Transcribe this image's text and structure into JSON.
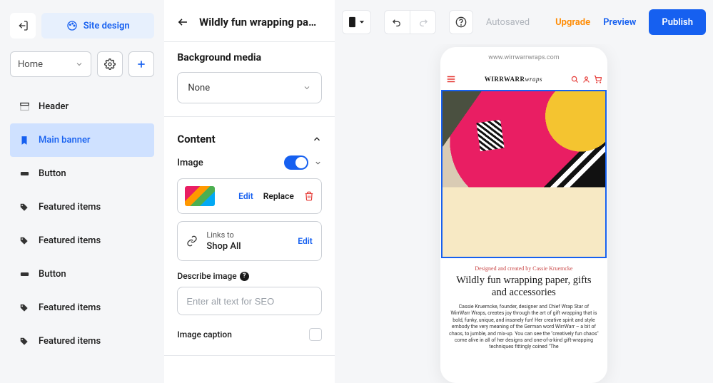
{
  "colors": {
    "primary": "#1660f0",
    "accent": "#ff8a00",
    "danger": "#e53935"
  },
  "left": {
    "site_design": "Site design",
    "page_select": "Home",
    "sections": [
      {
        "icon": "header",
        "label": "Header"
      },
      {
        "icon": "bookmark",
        "label": "Main banner",
        "active": true
      },
      {
        "icon": "button",
        "label": "Button"
      },
      {
        "icon": "tag",
        "label": "Featured items"
      },
      {
        "icon": "tag",
        "label": "Featured items"
      },
      {
        "icon": "button",
        "label": "Button"
      },
      {
        "icon": "tag",
        "label": "Featured items"
      },
      {
        "icon": "tag",
        "label": "Featured items"
      }
    ]
  },
  "mid": {
    "title": "Wildly fun wrapping paper…",
    "bg_media_label": "Background media",
    "bg_media_value": "None",
    "content_label": "Content",
    "image_label": "Image",
    "image_toggle": true,
    "edit": "Edit",
    "replace": "Replace",
    "links_to_label": "Links to",
    "links_to_value": "Shop All",
    "alt_label": "Describe image",
    "alt_placeholder": "Enter alt text for SEO",
    "caption_label": "Image caption",
    "caption_checked": false
  },
  "top": {
    "autosaved": "Autosaved",
    "upgrade": "Upgrade",
    "preview": "Preview",
    "publish": "Publish"
  },
  "preview": {
    "url": "www.wirrwarrwraps.com",
    "brand_pre": "WIRRWARR",
    "brand_ital": "wraps",
    "caption": "Designed and created by Cassie Kruemcke",
    "title": "Wildly fun wrapping paper, gifts and accessories",
    "body": "Cassie Kruemcke, founder, designer and Chief Wrap Star of WirrWarr Wraps, creates joy through the art of gift wrapping that is bold, funky, unique, and insanely fun! Her creative spirit and style embody the very meaning of the German word WirrWarr – a bit of chaos, to jumble, and mix-up. You can see the \"creatively fun chaos\" come alive in all of her designs and one-of-a-kind gift-wrapping techniques fittingly coined \"The"
  }
}
